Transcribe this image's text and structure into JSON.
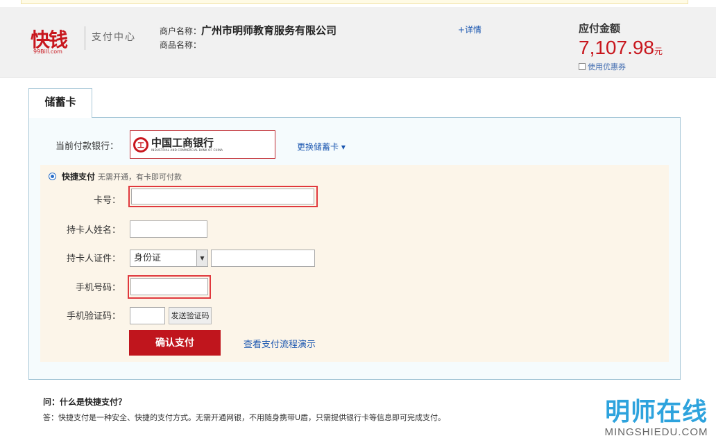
{
  "header": {
    "logo_text": "快钱",
    "logo_sub": "99Bill.com",
    "brand_subtitle": "支付中心",
    "merchant_label": "商户名称：",
    "merchant_name": "广州市明师教育服务有限公司",
    "product_label": "商品名称：",
    "details_link": "+详情",
    "amount_label": "应付金额",
    "amount_value": "7,107.98",
    "amount_unit": "元",
    "coupon_label": "使用优惠券"
  },
  "tabs": [
    {
      "label": "储蓄卡"
    }
  ],
  "bank": {
    "label": "当前付款银行：",
    "bank_name_cn": "中国工商银行",
    "bank_name_en": "INDUSTRIAL AND COMMERCIAL BANK OF CHINA",
    "change_link": "更换储蓄卡 ▾"
  },
  "quick_pay": {
    "label": "快捷支付",
    "description": "无需开通，有卡即可付款"
  },
  "form": {
    "card_number_label": "卡号：",
    "holder_name_label": "持卡人姓名：",
    "holder_id_label": "持卡人证件：",
    "id_type_selected": "身份证",
    "phone_label": "手机号码：",
    "sms_code_label": "手机验证码：",
    "send_code_button": "发送验证码",
    "confirm_button": "确认支付",
    "demo_link": "查看支付流程演示"
  },
  "faq": {
    "question": "问：什么是快捷支付？",
    "answer": "答：快捷支付是一种安全、快捷的支付方式。无需开通网银，不用随身携带U盾，只需提供银行卡等信息即可完成支付。"
  },
  "watermark": {
    "cn": "明师在线",
    "en": "MINGSHIEDU.COM"
  },
  "colors": {
    "brand_red": "#c8161d",
    "link_blue": "#1a56b0",
    "highlight_red": "#e0383d"
  }
}
